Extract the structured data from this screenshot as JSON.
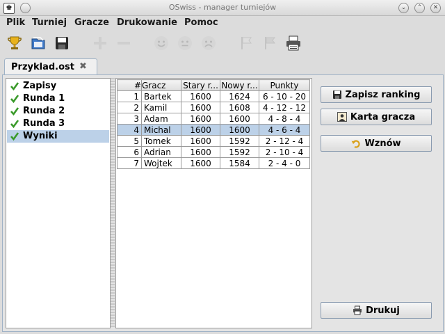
{
  "window": {
    "title": "OSwiss - manager turniejów"
  },
  "menu": [
    "Plik",
    "Turniej",
    "Gracze",
    "Drukowanie",
    "Pomoc"
  ],
  "tab": {
    "label": "Przyklad.ost",
    "close": "✖"
  },
  "nav": [
    {
      "label": "Zapisy"
    },
    {
      "label": "Runda 1"
    },
    {
      "label": "Runda 2"
    },
    {
      "label": "Runda 3"
    },
    {
      "label": "Wyniki",
      "selected": true
    }
  ],
  "table": {
    "headers": [
      "#",
      "Gracz",
      "Stary r...",
      "Nowy r...",
      "Punkty"
    ],
    "rows": [
      [
        "1",
        "Bartek",
        "1600",
        "1624",
        "6 - 10 - 20"
      ],
      [
        "2",
        "Kamil",
        "1600",
        "1608",
        "4 - 12 - 12"
      ],
      [
        "3",
        "Adam",
        "1600",
        "1600",
        "4 - 8 - 4"
      ],
      [
        "4",
        "Michal",
        "1600",
        "1600",
        "4 - 6 - 4"
      ],
      [
        "5",
        "Tomek",
        "1600",
        "1592",
        "2 - 12 - 4"
      ],
      [
        "6",
        "Adrian",
        "1600",
        "1592",
        "2 - 10 - 4"
      ],
      [
        "7",
        "Wojtek",
        "1600",
        "1584",
        "2 - 4 - 0"
      ]
    ],
    "selected_row": 3
  },
  "buttons": {
    "save_ranking": "Zapisz ranking",
    "player_card": "Karta gracza",
    "resume": "Wznów",
    "print": "Drukuj"
  },
  "colors": {
    "selection": "#bcd1e8",
    "check": "#3a9a2a",
    "border": "#9fb2c6"
  }
}
